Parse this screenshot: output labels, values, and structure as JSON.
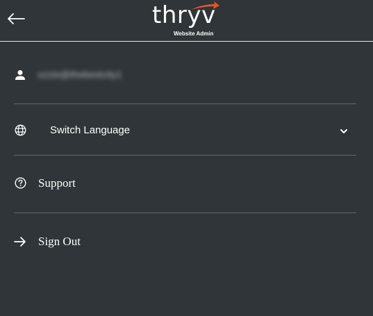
{
  "header": {
    "back_icon": "arrow-left-icon",
    "brand": {
      "name": "thryv",
      "subtitle": "Website Admin",
      "accent_color": "#e8542a"
    }
  },
  "menu": {
    "user": {
      "icon": "person-icon",
      "email": "ozzie@thebestcity1"
    },
    "language": {
      "icon": "globe-icon",
      "label": "Switch Language",
      "chevron_icon": "chevron-down-icon"
    },
    "support": {
      "icon": "help-circle-icon",
      "label": "Support"
    },
    "sign_out": {
      "icon": "arrow-right-icon",
      "label": "Sign Out"
    }
  },
  "colors": {
    "background": "#2f3538",
    "divider": "#626a6e",
    "header_border": "#e9ecec",
    "text": "#ffffff"
  }
}
